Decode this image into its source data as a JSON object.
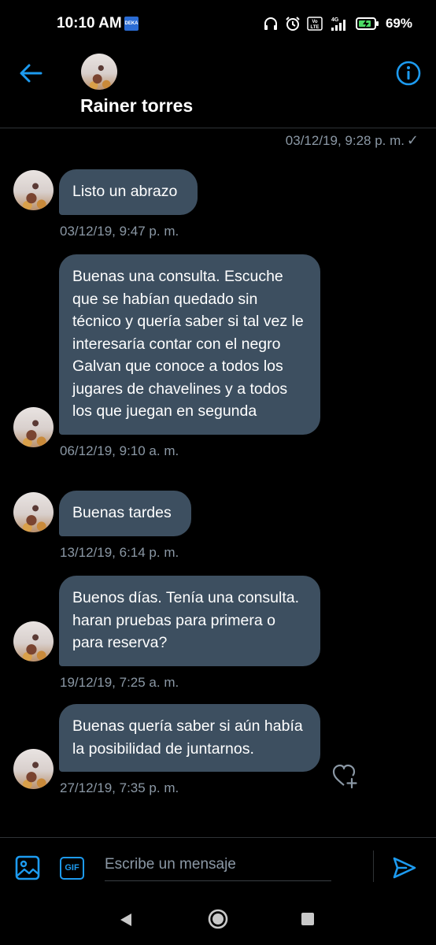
{
  "status_bar": {
    "time": "10:10 AM",
    "app_badge": "DEKA",
    "battery": "69%",
    "network_label": "4G",
    "volte_label": "Vo LTE"
  },
  "header": {
    "name": "Rainer torres",
    "back_icon": "arrow-left-icon",
    "info_icon": "info-icon"
  },
  "sent_message": {
    "time": "03/12/19, 9:28 p. m.",
    "status": "✓"
  },
  "messages": [
    {
      "text": "Listo un abrazo",
      "time": "03/12/19, 9:47 p. m."
    },
    {
      "text": "Buenas una consulta. Escuche que se habían quedado sin técnico y quería saber si tal vez le interesaría contar con el negro Galvan que conoce a todos los jugares de chavelines y a todos los que juegan en segunda",
      "time": "06/12/19, 9:10 a. m."
    },
    {
      "text": "Buenas tardes",
      "time": "13/12/19, 6:14 p. m."
    },
    {
      "text": "Buenos días. Tenía una consulta. haran pruebas para primera o para reserva?",
      "time": "19/12/19, 7:25 a. m."
    },
    {
      "text": "Buenas quería saber si aún había la posibilidad de juntarnos.",
      "time": "27/12/19, 7:35 p. m."
    }
  ],
  "compose": {
    "placeholder": "Escribe un mensaje",
    "gif_label": "GIF"
  },
  "colors": {
    "accent": "#1d9bf0",
    "bubble": "#3d4f60",
    "background": "#000000",
    "muted_text": "#8b98a5"
  }
}
